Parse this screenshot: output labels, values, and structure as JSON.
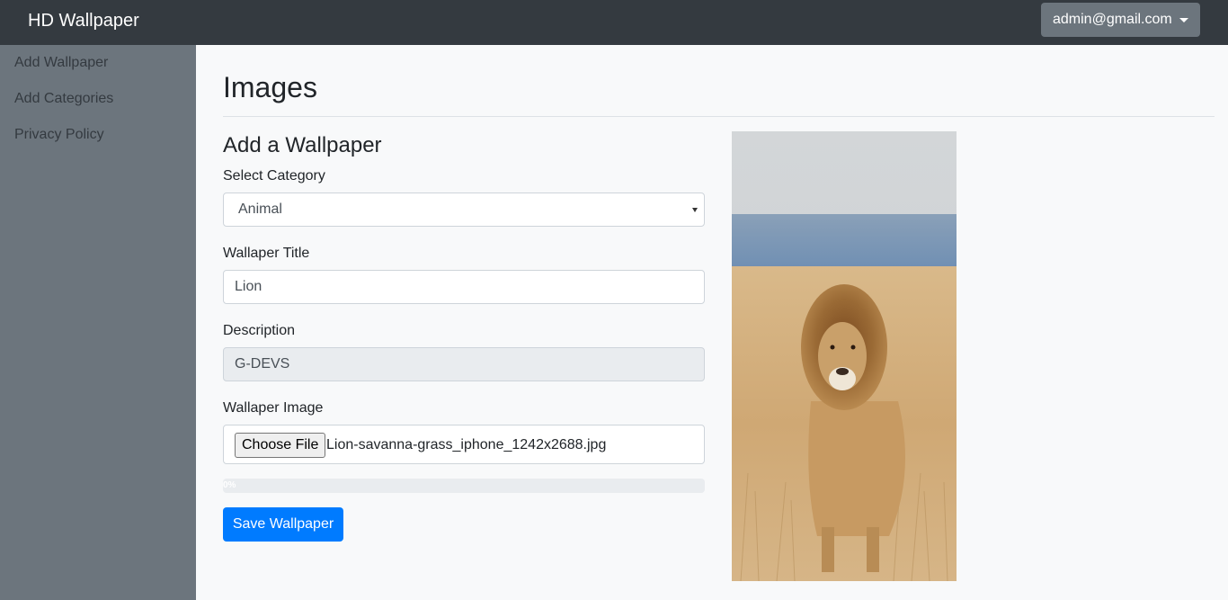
{
  "navbar": {
    "brand": "HD Wallpaper",
    "user_email": "admin@gmail.com"
  },
  "sidebar": {
    "items": [
      {
        "label": "Add Wallpaper"
      },
      {
        "label": "Add Categories"
      },
      {
        "label": "Privacy Policy"
      }
    ]
  },
  "main": {
    "page_title": "Images",
    "form_title": "Add a Wallpaper",
    "category": {
      "label": "Select Category",
      "value": "Animal"
    },
    "title_field": {
      "label": "Wallaper Title",
      "value": "Lion"
    },
    "description": {
      "label": "Description",
      "value": "G-DEVS"
    },
    "image_field": {
      "label": "Wallaper Image",
      "button": "Choose File",
      "file_name": "Lion-savanna-grass_iphone_1242x2688.jpg"
    },
    "progress": {
      "value": 0,
      "text": "0%"
    },
    "save_button": "Save Wallpaper"
  },
  "preview": {
    "icon": "lion-photo"
  },
  "colors": {
    "navbar": "#343a40",
    "sidebar": "#6c757d",
    "primary": "#007bff",
    "background": "#f8f9fa"
  }
}
